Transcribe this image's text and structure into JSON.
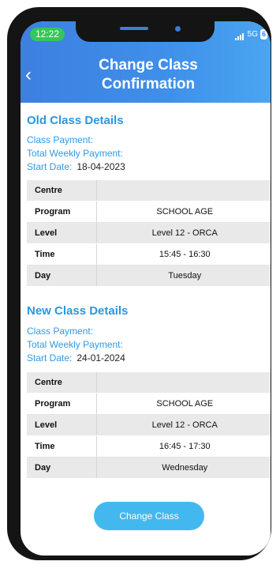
{
  "status_bar": {
    "time": "12:22",
    "network": "5G",
    "battery": "6"
  },
  "header": {
    "title": "Change Class Confirmation"
  },
  "old_class": {
    "title": "Old Class Details",
    "class_payment_label": "Class Payment:",
    "total_weekly_label": "Total Weekly Payment:",
    "start_date_label": "Start Date:",
    "start_date": "18-04-2023",
    "rows": [
      {
        "key": "Centre",
        "value": ""
      },
      {
        "key": "Program",
        "value": "SCHOOL AGE"
      },
      {
        "key": "Level",
        "value": "Level 12 - ORCA"
      },
      {
        "key": "Time",
        "value": "15:45 - 16:30"
      },
      {
        "key": "Day",
        "value": "Tuesday"
      }
    ]
  },
  "new_class": {
    "title": "New Class Details",
    "class_payment_label": "Class Payment:",
    "total_weekly_label": "Total Weekly Payment:",
    "start_date_label": "Start Date:",
    "start_date": "24-01-2024",
    "rows": [
      {
        "key": "Centre",
        "value": ""
      },
      {
        "key": "Program",
        "value": "SCHOOL AGE"
      },
      {
        "key": "Level",
        "value": "Level 12 - ORCA"
      },
      {
        "key": "Time",
        "value": "16:45 - 17:30"
      },
      {
        "key": "Day",
        "value": "Wednesday"
      }
    ]
  },
  "actions": {
    "change_class_label": "Change Class"
  },
  "colors": {
    "accent": "#2b97de",
    "header": "#3f8ae6",
    "button": "#43b8ee"
  }
}
